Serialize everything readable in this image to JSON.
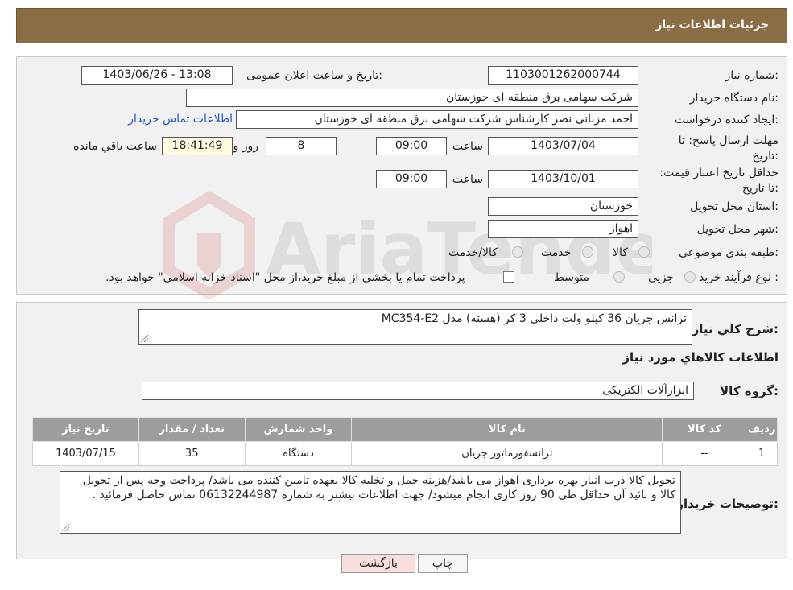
{
  "header": {
    "title": "جزئیات اطلاعات نیاز"
  },
  "form": {
    "need_number_label": "شماره نیاز:",
    "need_number": "1103001262000744",
    "announce_label": "تاریخ و ساعت اعلان عمومی:",
    "announce_value": "1403/06/26 - 13:08",
    "buyer_org_label": "نام دستگاه خریدار:",
    "buyer_org": "شرکت سهامی برق منطقه ای خوزستان",
    "requester_label": "ایجاد کننده درخواست:",
    "requester": "احمد مزبانی نصر کارشناس شرکت سهامی برق منطقه ای خوزستان",
    "contact_link": "اطلاعات تماس خریدار",
    "reply_deadline_label": "مهلت ارسال پاسخ: تا تاریخ:",
    "reply_date": "1403/07/04",
    "time_label": "ساعت",
    "reply_time": "09:00",
    "days_value": "8",
    "days_label": "روز و",
    "remaining_time": "18:41:49",
    "remaining_label": "ساعت باقي مانده",
    "price_validity_label": "حداقل تاریخ اعتبار قیمت: تا تاریخ:",
    "price_validity_date": "1403/10/01",
    "price_validity_time": "09:00",
    "province_label": "استان محل تحویل:",
    "province": "خوزستان",
    "city_label": "شهر محل تحویل:",
    "city": "اهواز",
    "category_label": "طبقه بندی موضوعی:",
    "category_options": [
      "کالا",
      "خدمت",
      "کالا/خدمت"
    ],
    "purchase_type_label": "نوع فرآیند خرید :",
    "purchase_options": [
      "جزیی",
      "متوسط"
    ],
    "purchase_note": "پرداخت تمام یا بخشی از مبلغ خرید،از محل \"اسناد خزانه اسلامی\" خواهد بود."
  },
  "description": {
    "label": "شرح کلي نیاز:",
    "value": "ترانس جریان 36 کیلو ولت داخلی 3 کر (هسته) مدل MC354-E2"
  },
  "goods_section": {
    "title": "اطلاعات کالاهاي مورد نیاز",
    "group_label": "گروه کالا:",
    "group_value": "ابزارآلات الکتریکی"
  },
  "table": {
    "headers": [
      "ردیف",
      "کد کالا",
      "نام کالا",
      "واحد شمارش",
      "تعداد / مقدار",
      "تاریخ نیاز"
    ],
    "rows": [
      [
        "1",
        "--",
        "ترانسفورماتور جریان",
        "دستگاه",
        "35",
        "1403/07/15"
      ]
    ]
  },
  "buyer_notes": {
    "label": "توضیحات خریدار:",
    "value": "تحویل کالا درب انبار بهره برداری اهواز می باشد/هزینه حمل و تخلیه کالا بعهده تامین کننده می باشد/ پرداخت وجه پس از تحویل کالا و تائید آن حداقل طی 90 روز کاری انجام میشود/  جهت اطلاعات بیشتر به شماره  06132244987 تماس حاصل فرمائید ."
  },
  "buttons": {
    "print": "چاپ",
    "back": "بازگشت"
  },
  "watermark": {
    "text": "AriaTender.neT"
  },
  "colors": {
    "header_bg": "#8b6d44",
    "table_header_bg": "#9d9d9d",
    "back_button_bg": "#f9dede",
    "link": "#2255cc"
  }
}
